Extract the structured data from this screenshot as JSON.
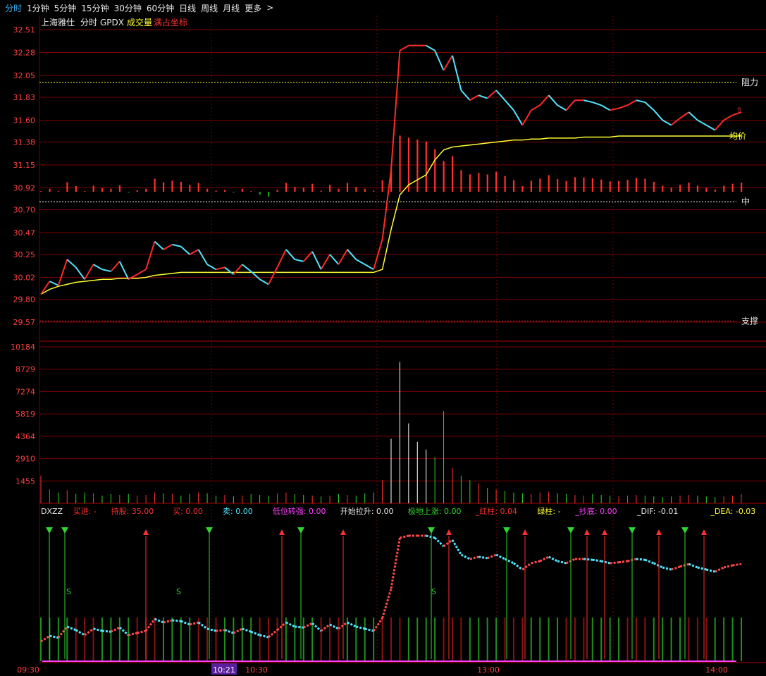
{
  "toolbar": {
    "tabs": [
      "分时",
      "1分钟",
      "5分钟",
      "15分钟",
      "30分钟",
      "60分钟",
      "日线",
      "周线",
      "月线",
      "更多"
    ],
    "more_arrow": ">"
  },
  "header": {
    "stock_name": "上海雅仕",
    "indicators": [
      "分时",
      "GPDX",
      "成交量"
    ],
    "indicator_extra": "满占坐标"
  },
  "colors": {
    "up": "#ff3030",
    "down": "#2fd72f",
    "price_up": "#ff2a2a",
    "price_down": "#4fe6ff",
    "avg": "#ffff30",
    "grid": "#7a0000",
    "axis_text": "#ff4040",
    "bg": "#000000"
  },
  "price_panel": {
    "labels": [
      "32.51",
      "32.28",
      "32.05",
      "31.83",
      "31.60",
      "31.38",
      "31.15",
      "30.92",
      "30.70",
      "30.47",
      "30.25",
      "30.02",
      "29.80",
      "29.57"
    ],
    "levels": [
      32.51,
      32.28,
      32.05,
      31.83,
      31.6,
      31.38,
      31.15,
      30.92,
      30.7,
      30.47,
      30.25,
      30.02,
      29.8,
      29.57
    ],
    "resistance": {
      "label": "阻力",
      "value": 31.98
    },
    "middle": {
      "label": "中",
      "value": 30.78
    },
    "support": {
      "label": "支撑",
      "value": 29.58
    },
    "avg_label": "均价",
    "up_arrow": "⇧"
  },
  "volume_panel": {
    "labels": [
      "10184",
      "8729",
      "7274",
      "5819",
      "4364",
      "2910",
      "1455"
    ],
    "levels": [
      10184,
      8729,
      7274,
      5819,
      4364,
      2910,
      1455
    ]
  },
  "indicator_bar": {
    "items": [
      {
        "label": "DXZZ",
        "color": "#e8e8e8"
      },
      {
        "label": "买进: -",
        "color": "#ff3030"
      },
      {
        "label": "持股: 35.00",
        "color": "#ff3030"
      },
      {
        "label": "买: 0.00",
        "color": "#ff3030"
      },
      {
        "label": "卖: 0.00",
        "color": "#4fe6ff"
      },
      {
        "label": "低位转强: 0.00",
        "color": "#ff40ff"
      },
      {
        "label": "开始拉升: 0.00",
        "color": "#e8e8e8"
      },
      {
        "label": "极地上涨: 0.00",
        "color": "#2fd72f"
      },
      {
        "label": "_红柱: 0.04",
        "color": "#ff3030"
      },
      {
        "label": "绿柱: -",
        "color": "#ffff30"
      },
      {
        "label": "_抄底: 0.00",
        "color": "#ff40ff"
      },
      {
        "label": "_DIF: -0.01",
        "color": "#e8e8e8"
      },
      {
        "label": "_DEA: -0.03",
        "color": "#ffff30"
      }
    ],
    "s_marker": "S"
  },
  "time_axis": {
    "labels": [
      "09:30",
      "10:21",
      "10:30",
      "13:00",
      "14:00"
    ],
    "cursor_label": "10:21"
  },
  "chart_data": {
    "type": "line",
    "title": "上海雅仕",
    "xlabel": "",
    "ylabel": "",
    "ylim": [
      29.57,
      32.51
    ],
    "x": [
      0,
      3,
      6,
      9,
      12,
      15,
      18,
      21,
      24,
      27,
      30,
      33,
      36,
      39,
      42,
      45,
      48,
      51,
      54,
      57,
      60,
      63,
      66,
      69,
      72,
      75,
      78,
      81,
      84,
      87,
      90,
      93,
      96,
      99,
      102,
      105,
      108,
      111,
      114,
      117,
      120,
      123,
      126,
      129,
      132,
      135,
      138,
      141,
      144,
      147,
      150,
      153,
      156,
      159,
      162,
      165,
      168,
      171,
      174,
      177,
      180,
      183,
      186,
      189,
      192,
      195,
      198,
      201,
      204,
      207,
      210,
      213,
      216,
      219,
      222,
      225,
      228,
      231,
      234,
      237,
      240
    ],
    "series": [
      {
        "values": [
          29.85,
          29.98,
          29.94,
          30.2,
          30.12,
          30.0,
          30.15,
          30.1,
          30.08,
          30.18,
          30.0,
          30.05,
          30.1,
          30.38,
          30.3,
          30.35,
          30.33,
          30.25,
          30.3,
          30.15,
          30.1,
          30.12,
          30.05,
          30.15,
          30.08,
          30.0,
          29.95,
          30.12,
          30.3,
          30.2,
          30.18,
          30.28,
          30.1,
          30.25,
          30.15,
          30.3,
          30.2,
          30.15,
          30.1,
          30.4,
          31.1,
          32.3,
          32.35,
          32.35,
          32.35,
          32.3,
          32.1,
          32.25,
          31.9,
          31.8,
          31.85,
          31.82,
          31.9,
          31.8,
          31.7,
          31.55,
          31.7,
          31.75,
          31.85,
          31.75,
          31.7,
          31.8,
          31.8,
          31.78,
          31.75,
          31.7,
          31.72,
          31.75,
          31.8,
          31.78,
          31.7,
          31.6,
          31.55,
          31.62,
          31.68,
          31.6,
          31.55,
          31.5,
          31.6,
          31.65,
          31.68
        ]
      },
      {
        "values": [
          29.85,
          29.9,
          29.93,
          29.95,
          29.97,
          29.98,
          29.99,
          30.0,
          30.0,
          30.01,
          30.01,
          30.01,
          30.02,
          30.04,
          30.05,
          30.06,
          30.07,
          30.07,
          30.07,
          30.07,
          30.07,
          30.07,
          30.07,
          30.07,
          30.07,
          30.07,
          30.07,
          30.07,
          30.07,
          30.07,
          30.07,
          30.07,
          30.07,
          30.07,
          30.07,
          30.07,
          30.07,
          30.07,
          30.07,
          30.1,
          30.5,
          30.85,
          30.95,
          31.0,
          31.05,
          31.2,
          31.3,
          31.33,
          31.34,
          31.35,
          31.36,
          31.37,
          31.38,
          31.39,
          31.4,
          31.4,
          31.41,
          31.41,
          31.42,
          31.42,
          31.42,
          31.42,
          31.43,
          31.43,
          31.43,
          31.43,
          31.44,
          31.44,
          31.44,
          31.44,
          31.44,
          31.44,
          31.44,
          31.44,
          31.44,
          31.44,
          31.44,
          31.44,
          31.44,
          31.44,
          31.44
        ]
      }
    ],
    "volume": [
      1800,
      900,
      700,
      850,
      600,
      700,
      650,
      500,
      600,
      550,
      600,
      500,
      550,
      700,
      650,
      600,
      500,
      600,
      700,
      650,
      500,
      550,
      450,
      500,
      600,
      550,
      500,
      650,
      700,
      600,
      550,
      500,
      450,
      500,
      600,
      550,
      500,
      650,
      700,
      1500,
      4200,
      9200,
      5200,
      4000,
      3500,
      3000,
      6000,
      2300,
      1800,
      1500,
      1300,
      1000,
      900,
      800,
      700,
      650,
      600,
      700,
      750,
      650,
      600,
      550,
      500,
      600,
      550,
      500,
      450,
      500,
      550,
      500,
      450,
      400,
      450,
      500,
      550,
      500,
      450,
      400,
      450,
      500,
      600
    ]
  }
}
